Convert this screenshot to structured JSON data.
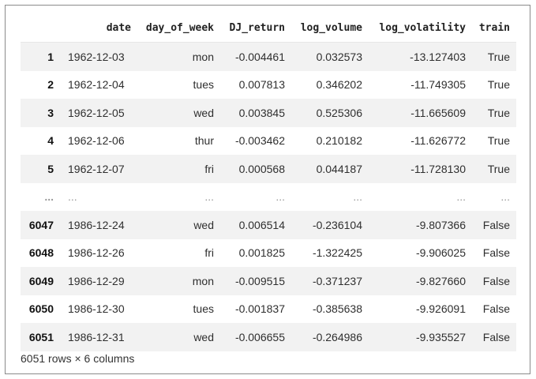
{
  "dataframe": {
    "columns": [
      "date",
      "day_of_week",
      "DJ_return",
      "log_volume",
      "log_volatility",
      "train"
    ],
    "rows": [
      {
        "index": "1",
        "cells": [
          "1962-12-03",
          "mon",
          "-0.004461",
          "0.032573",
          "-13.127403",
          "True"
        ]
      },
      {
        "index": "2",
        "cells": [
          "1962-12-04",
          "tues",
          "0.007813",
          "0.346202",
          "-11.749305",
          "True"
        ]
      },
      {
        "index": "3",
        "cells": [
          "1962-12-05",
          "wed",
          "0.003845",
          "0.525306",
          "-11.665609",
          "True"
        ]
      },
      {
        "index": "4",
        "cells": [
          "1962-12-06",
          "thur",
          "-0.003462",
          "0.210182",
          "-11.626772",
          "True"
        ]
      },
      {
        "index": "5",
        "cells": [
          "1962-12-07",
          "fri",
          "0.000568",
          "0.044187",
          "-11.728130",
          "True"
        ]
      },
      {
        "index": "...",
        "cells": [
          "...",
          "...",
          "...",
          "...",
          "...",
          "..."
        ]
      },
      {
        "index": "6047",
        "cells": [
          "1986-12-24",
          "wed",
          "0.006514",
          "-0.236104",
          "-9.807366",
          "False"
        ]
      },
      {
        "index": "6048",
        "cells": [
          "1986-12-26",
          "fri",
          "0.001825",
          "-1.322425",
          "-9.906025",
          "False"
        ]
      },
      {
        "index": "6049",
        "cells": [
          "1986-12-29",
          "mon",
          "-0.009515",
          "-0.371237",
          "-9.827660",
          "False"
        ]
      },
      {
        "index": "6050",
        "cells": [
          "1986-12-30",
          "tues",
          "-0.001837",
          "-0.385638",
          "-9.926091",
          "False"
        ]
      },
      {
        "index": "6051",
        "cells": [
          "1986-12-31",
          "wed",
          "-0.006655",
          "-0.264986",
          "-9.935527",
          "False"
        ]
      }
    ],
    "footer": "6051 rows × 6 columns"
  }
}
